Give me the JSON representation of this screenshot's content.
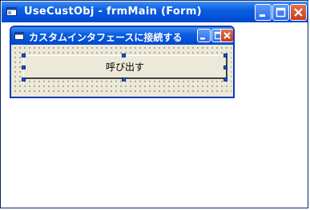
{
  "outer_window": {
    "title": "UseCustObj - frmMain (Form)"
  },
  "inner_window": {
    "title": "カスタムインタフェースに接続する"
  },
  "command_button": {
    "label": "呼び出す"
  },
  "colors": {
    "title_bar": "#0a5fe0",
    "form_background": "#ece9d8",
    "close_button": "#c43c1a",
    "selection_handle": "#1c4fc4"
  }
}
